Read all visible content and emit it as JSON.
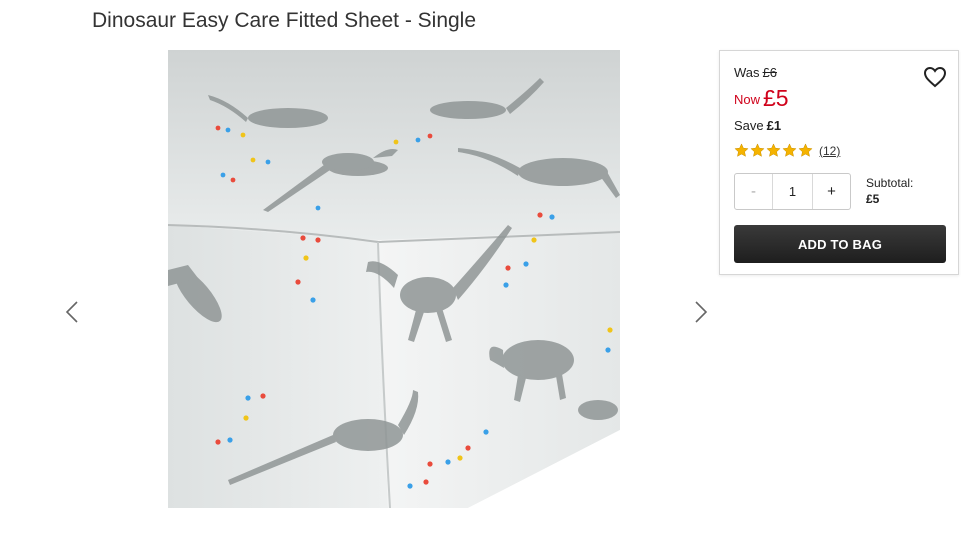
{
  "product": {
    "title": "Dinosaur Easy Care Fitted Sheet - Single"
  },
  "gallery": {
    "prev_icon": "chevron-left-icon",
    "next_icon": "chevron-right-icon",
    "image_subject": "dinosaur print fitted sheet"
  },
  "pricing": {
    "was_label": "Was",
    "was_price": "£6",
    "now_label": "Now",
    "now_price": "£5",
    "save_label": "Save",
    "save_amount": "£1",
    "sale_color": "#d0021b"
  },
  "rating": {
    "stars": 5,
    "max": 5,
    "review_count": "(12)",
    "star_color": "#f5b300"
  },
  "quantity": {
    "minus_label": "-",
    "value": "1",
    "plus_label": "+"
  },
  "subtotal": {
    "label": "Subtotal:",
    "value": "£5"
  },
  "actions": {
    "add_to_bag": "ADD TO BAG",
    "wishlist_icon": "heart-icon"
  }
}
